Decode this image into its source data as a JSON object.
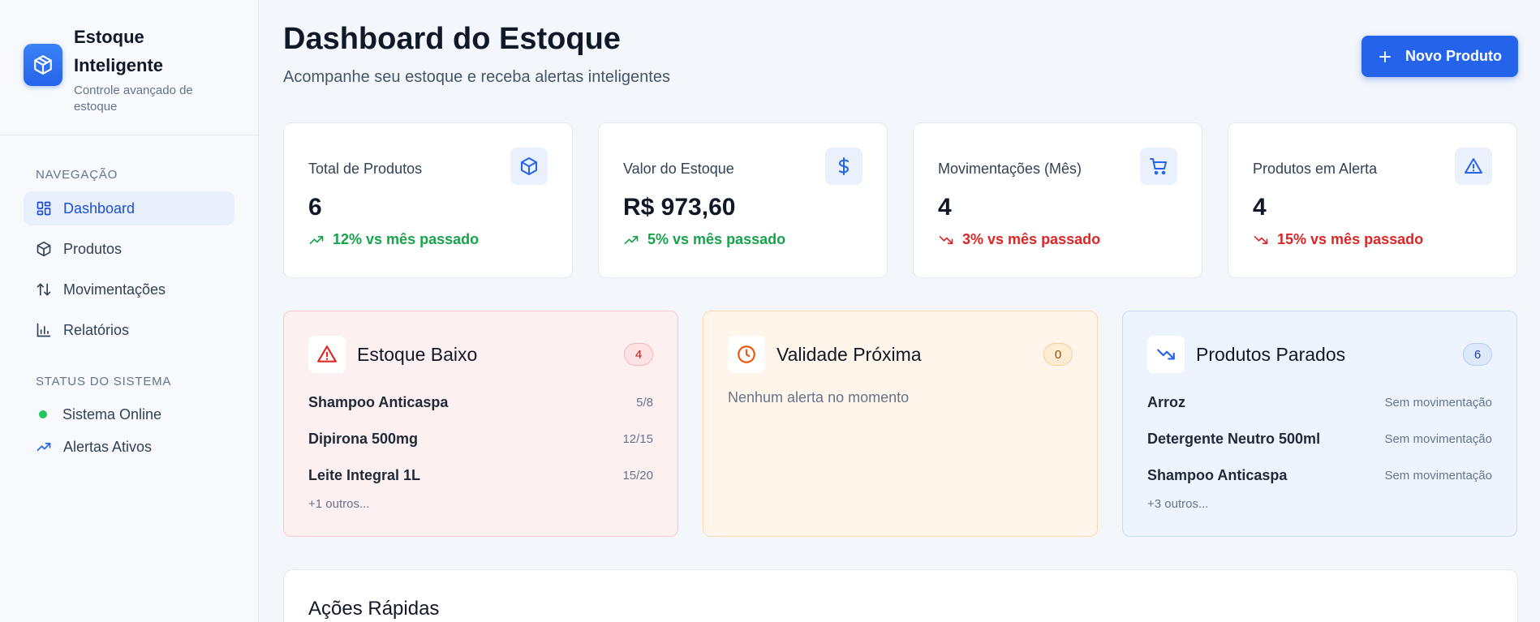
{
  "brand": {
    "title": "Estoque Inteligente",
    "subtitle": "Controle avançado de estoque"
  },
  "sidebar": {
    "nav_heading": "NAVEGAÇÃO",
    "items": [
      {
        "label": "Dashboard",
        "icon": "dashboard-icon",
        "active": true
      },
      {
        "label": "Produtos",
        "icon": "package-icon",
        "active": false
      },
      {
        "label": "Movimentações",
        "icon": "arrows-up-down-icon",
        "active": false
      },
      {
        "label": "Relatórios",
        "icon": "bar-chart-icon",
        "active": false
      }
    ],
    "status_heading": "STATUS DO SISTEMA",
    "status": [
      {
        "label": "Sistema Online",
        "icon": "online-dot-icon",
        "color": "#22c55e"
      },
      {
        "label": "Alertas Ativos",
        "icon": "trending-up-icon",
        "color": "#2563eb"
      }
    ]
  },
  "header": {
    "title": "Dashboard do Estoque",
    "subtitle": "Acompanhe seu estoque e receba alertas inteligentes",
    "new_product_button": "Novo Produto"
  },
  "stats": [
    {
      "label": "Total de Produtos",
      "value": "6",
      "trend": "12% vs mês passado",
      "direction": "up",
      "icon": "package-icon"
    },
    {
      "label": "Valor do Estoque",
      "value": "R$ 973,60",
      "trend": "5% vs mês passado",
      "direction": "up",
      "icon": "dollar-icon"
    },
    {
      "label": "Movimentações (Mês)",
      "value": "4",
      "trend": "3% vs mês passado",
      "direction": "down",
      "icon": "cart-icon"
    },
    {
      "label": "Produtos em Alerta",
      "value": "4",
      "trend": "15% vs mês passado",
      "direction": "down",
      "icon": "alert-triangle-icon"
    }
  ],
  "alerts": {
    "low_stock": {
      "title": "Estoque Baixo",
      "count": "4",
      "items": [
        {
          "name": "Shampoo Anticaspa",
          "meta": "5/8"
        },
        {
          "name": "Dipirona 500mg",
          "meta": "12/15"
        },
        {
          "name": "Leite Integral 1L",
          "meta": "15/20"
        }
      ],
      "more": "+1 outros..."
    },
    "expiring": {
      "title": "Validade Próxima",
      "count": "0",
      "empty": "Nenhum alerta no momento"
    },
    "idle": {
      "title": "Produtos Parados",
      "count": "6",
      "items": [
        {
          "name": "Arroz",
          "meta": "Sem movimentação"
        },
        {
          "name": "Detergente Neutro 500ml",
          "meta": "Sem movimentação"
        },
        {
          "name": "Shampoo Anticaspa",
          "meta": "Sem movimentação"
        }
      ],
      "more": "+3 outros..."
    }
  },
  "quick_actions": {
    "title": "Ações Rápidas"
  },
  "colors": {
    "accent": "#2563eb",
    "success": "#16a34a",
    "danger": "#dc2626",
    "warning": "#ea580c"
  }
}
